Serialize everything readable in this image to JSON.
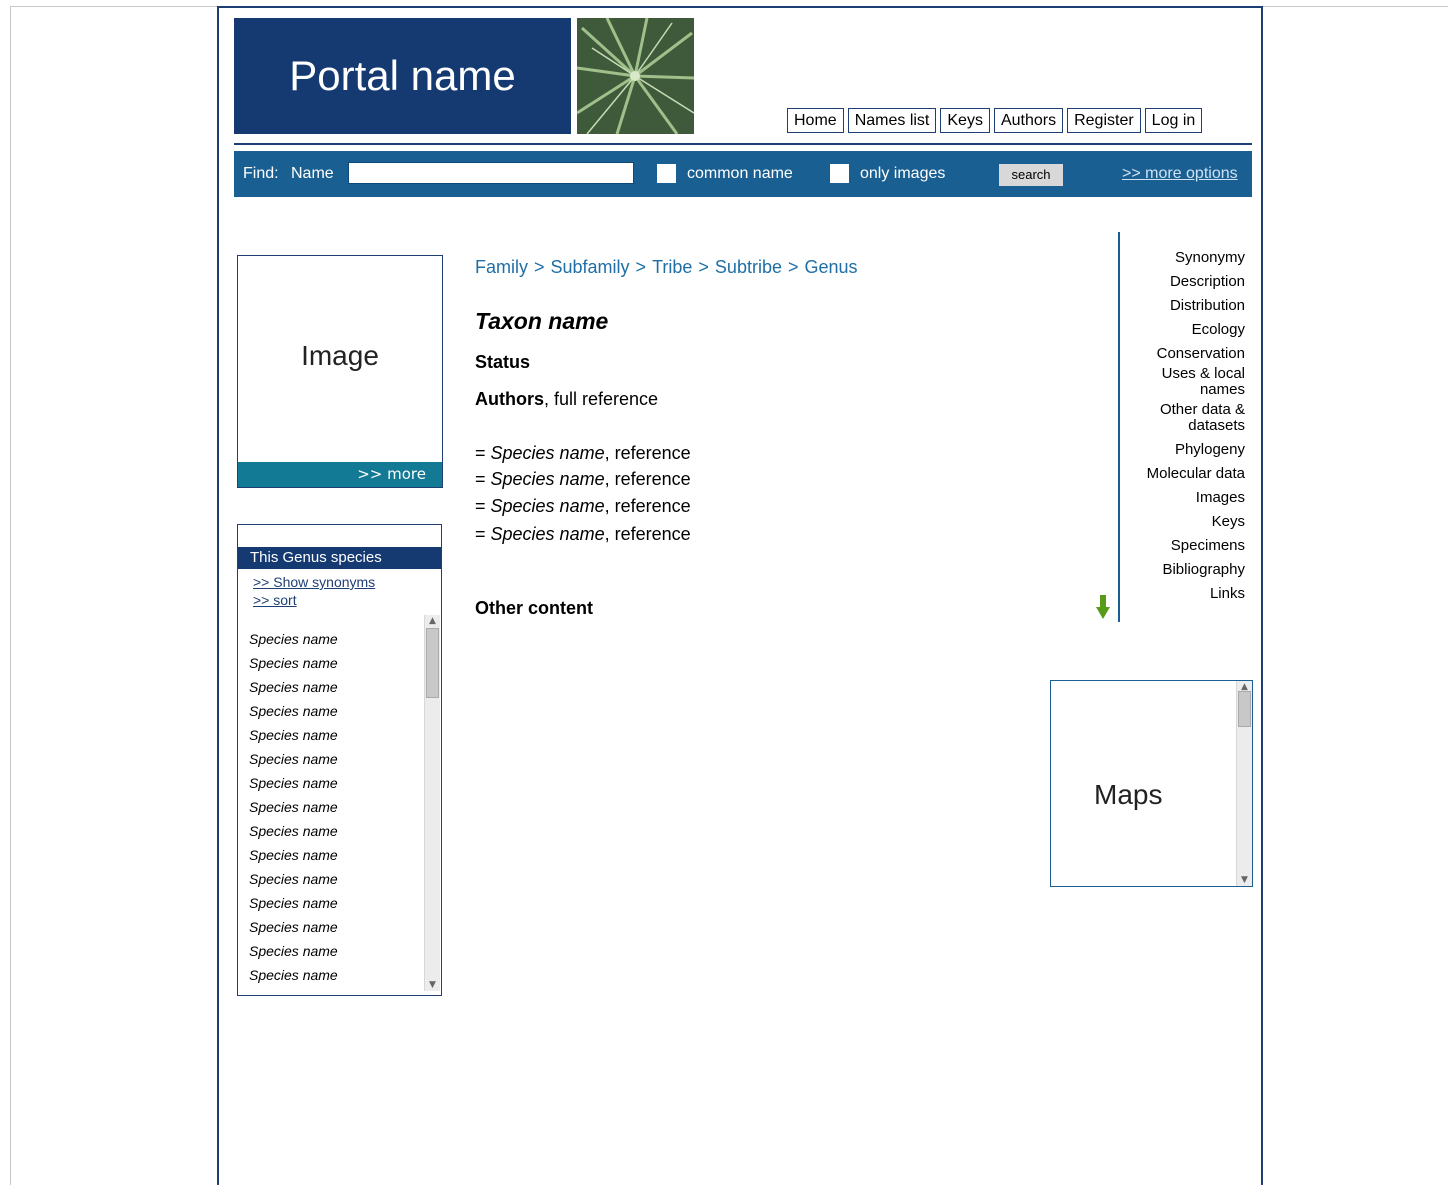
{
  "header": {
    "portal_name": "Portal name",
    "nav": [
      "Home",
      "Names list",
      "Keys",
      "Authors",
      "Register",
      "Log in"
    ]
  },
  "find_bar": {
    "find_label": "Find:",
    "name_label": "Name",
    "name_value": "",
    "common_name_label": "common name",
    "only_images_label": "only images",
    "search_button": "search",
    "more_options": ">> more options"
  },
  "image_box": {
    "label": "Image",
    "more": ">> more"
  },
  "species_panel": {
    "title": "This Genus species",
    "show_synonyms": ">> Show synonyms",
    "sort": ">> sort",
    "items": [
      "Species name",
      "Species name",
      "Species name",
      "Species name",
      "Species name",
      "Species name",
      "Species name",
      "Species name",
      "Species name",
      "Species name",
      "Species name",
      "Species name",
      "Species name",
      "Species name",
      "Species name"
    ]
  },
  "breadcrumb": [
    "Family",
    "Subfamily",
    "Tribe",
    "Subtribe",
    "Genus"
  ],
  "breadcrumb_sep": ">",
  "taxon": {
    "name": "Taxon name",
    "status": "Status",
    "authors": "Authors",
    "reference": ", full reference"
  },
  "synonyms": [
    {
      "prefix": "= ",
      "name": "Species name",
      "ref": ", reference"
    },
    {
      "prefix": "= ",
      "name": "Species name",
      "ref": ", reference"
    },
    {
      "prefix": "= ",
      "name": "Species name",
      "ref": ", reference"
    },
    {
      "prefix": "= ",
      "name": "Species name",
      "ref": ", reference"
    }
  ],
  "other_content": "Other content",
  "right_nav": [
    "Synonymy",
    "Description",
    "Distribution",
    "Ecology",
    "Conservation",
    "Uses & local names",
    "Other data & datasets",
    "Phylogeny",
    "Molecular data",
    "Images",
    "Keys",
    "Specimens",
    "Bibliography",
    "Links"
  ],
  "maps_box": {
    "label": "Maps"
  },
  "colors": {
    "brand_navy": "#153a72",
    "bar_blue": "#1a5f92",
    "teal": "#127a95",
    "link_blue": "#1f6fa6",
    "arrow_green": "#5a9a1a"
  }
}
